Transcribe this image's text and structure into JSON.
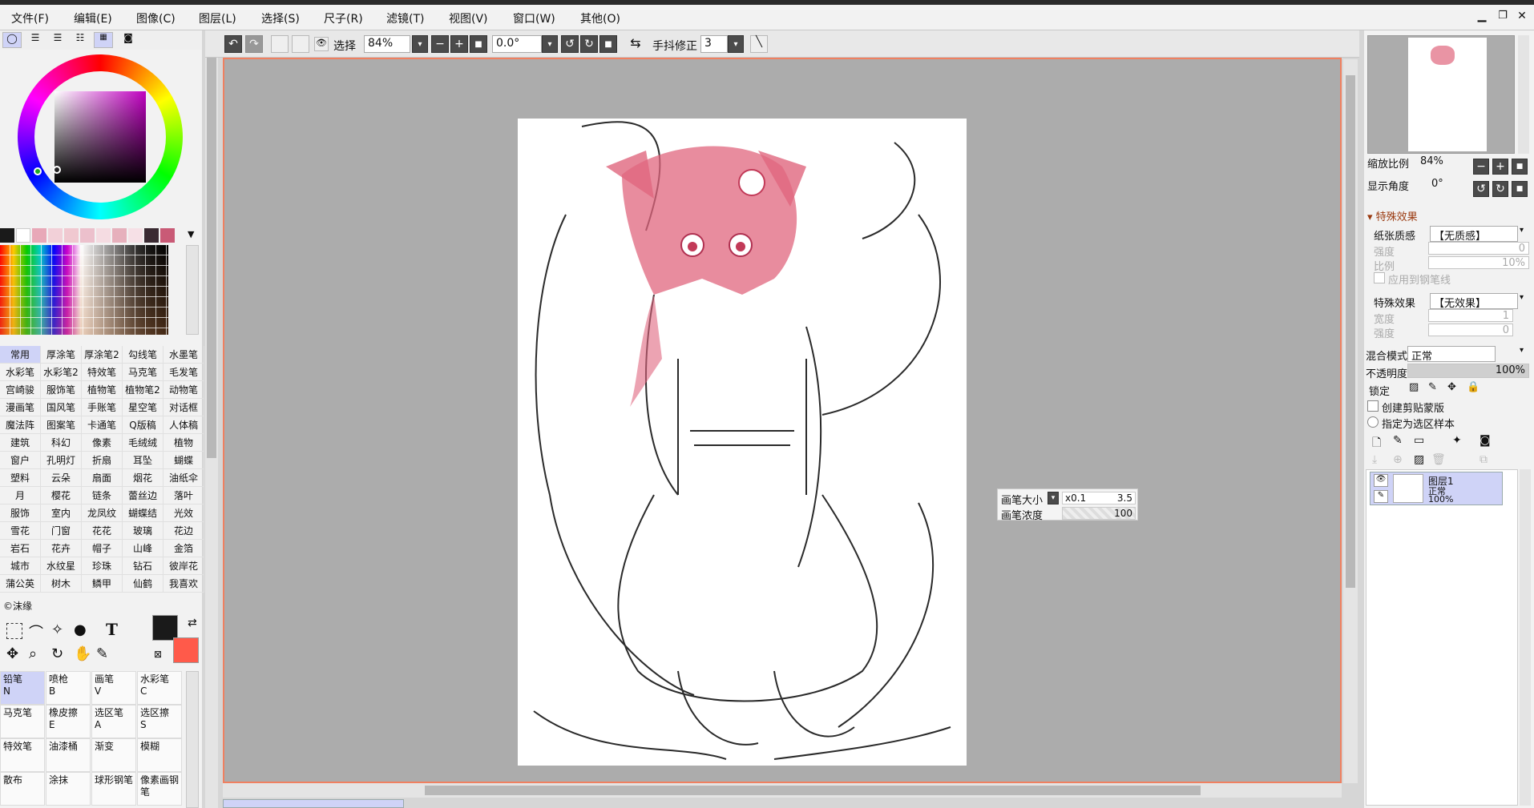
{
  "menubar": {
    "items": [
      "文件(F)",
      "编辑(E)",
      "图像(C)",
      "图层(L)",
      "选择(S)",
      "尺子(R)",
      "滤镜(T)",
      "视图(V)",
      "窗口(W)",
      "其他(O)"
    ]
  },
  "toolbar": {
    "select_label": "选择",
    "zoom": "84%",
    "angle": "0.0°",
    "stab_label": "手抖修正",
    "stab_value": "3"
  },
  "brush_tabs": [
    "常用",
    "厚涂笔",
    "厚涂笔2",
    "勾线笔",
    "水墨笔",
    "水彩笔",
    "水彩笔2",
    "特效笔",
    "马克笔",
    "毛发笔",
    "宫崎骏",
    "服饰笔",
    "植物笔",
    "植物笔2",
    "动物笔",
    "漫画笔",
    "国风笔",
    "手账笔",
    "星空笔",
    "对话框",
    "魔法阵",
    "图案笔",
    "卡通笔",
    "Q版稿",
    "人体稿",
    "建筑",
    "科幻",
    "像素",
    "毛绒绒",
    "植物",
    "窗户",
    "孔明灯",
    "折扇",
    "耳坠",
    "蝴蝶",
    "塑料",
    "云朵",
    "扇面",
    "烟花",
    "油纸伞",
    "月",
    "樱花",
    "链条",
    "蕾丝边",
    "落叶",
    "服饰",
    "室内",
    "龙凤纹",
    "蝴蝶结",
    "光效",
    "雪花",
    "门窗",
    "花花",
    "玻璃",
    "花边",
    "岩石",
    "花卉",
    "帽子",
    "山峰",
    "金箔",
    "城市",
    "水纹星",
    "珍珠",
    "钻石",
    "彼岸花",
    "蒲公英",
    "树木",
    "鳞甲",
    "仙鹤",
    "我喜欢"
  ],
  "credit": "©沫缘",
  "tools": [
    {
      "name": "铅笔",
      "key": "N"
    },
    {
      "name": "喷枪",
      "key": "B"
    },
    {
      "name": "画笔",
      "key": "V"
    },
    {
      "name": "水彩笔",
      "key": "C"
    },
    {
      "name": "马克笔",
      "key": ""
    },
    {
      "name": "橡皮擦",
      "key": "E"
    },
    {
      "name": "选区笔",
      "key": "A"
    },
    {
      "name": "选区擦",
      "key": "S"
    },
    {
      "name": "特效笔",
      "key": ""
    },
    {
      "name": "油漆桶",
      "key": ""
    },
    {
      "name": "渐变",
      "key": ""
    },
    {
      "name": "模糊",
      "key": ""
    },
    {
      "name": "散布",
      "key": ""
    },
    {
      "name": "涂抹",
      "key": ""
    },
    {
      "name": "球形钢笔",
      "key": ""
    },
    {
      "name": "像素画钢笔",
      "key": ""
    }
  ],
  "colors": {
    "accent": "#cfd3f7",
    "foreground": "#1a1a1a",
    "background": "#ff5a4a"
  },
  "brush_panel": {
    "size_label": "画笔大小",
    "size_mult": "x0.1",
    "size_value": "3.5",
    "density_label": "画笔浓度",
    "density_value": "100"
  },
  "navigator": {
    "zoom_label": "缩放比例",
    "zoom_value": "84%",
    "angle_label": "显示角度",
    "angle_value": "0°"
  },
  "effects": {
    "header": "特殊效果",
    "texture_label": "纸张质感",
    "texture_value": "【无质感】",
    "strength_label": "强度",
    "strength_value": "0",
    "scale_label": "比例",
    "scale_value": "10%",
    "apply_label": "应用到钢笔线",
    "effect_label": "特殊效果",
    "effect_value": "【无效果】",
    "width_label": "宽度",
    "width_value": "1",
    "strength2_label": "强度",
    "strength2_value": "0"
  },
  "layer_props": {
    "blend_label": "混合模式",
    "blend_value": "正常",
    "opacity_label": "不透明度",
    "opacity_value": "100%",
    "lock_label": "锁定",
    "clip_label": "创建剪贴蒙版",
    "sample_label": "指定为选区样本"
  },
  "layers": [
    {
      "name": "图层1",
      "mode": "正常",
      "opacity": "100%"
    }
  ]
}
